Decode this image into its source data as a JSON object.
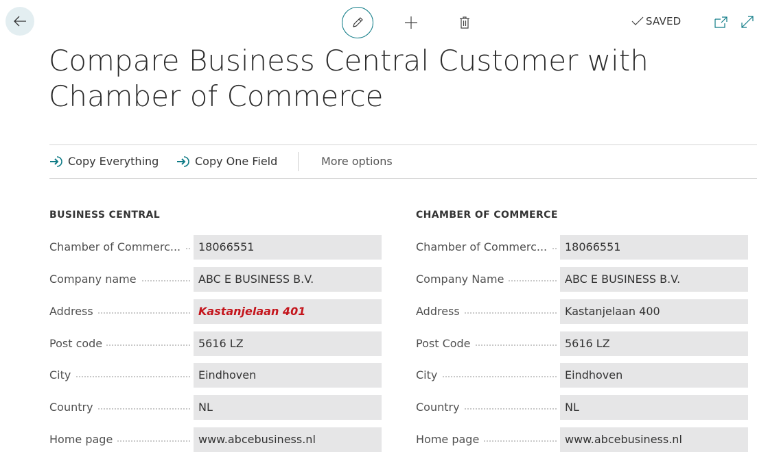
{
  "toolbar": {
    "back_icon": "arrow-left-icon",
    "edit_icon": "pencil-icon",
    "add_icon": "plus-icon",
    "delete_icon": "trash-icon",
    "status_text": "SAVED",
    "status_icon": "checkmark-icon",
    "open_new_icon": "open-in-new-window-icon",
    "expand_icon": "expand-icon",
    "accent_color": "#0f7b86"
  },
  "page": {
    "title": "Compare Business Central Customer with Chamber of Commerce"
  },
  "actions": {
    "copy_everything": "Copy Everything",
    "copy_one_field": "Copy One Field",
    "more_options": "More options",
    "action_icon": "arrow-into-icon"
  },
  "business_central": {
    "caption": "BUSINESS CENTRAL",
    "fields": [
      {
        "label": "Chamber of Commerc...",
        "value": "18066551"
      },
      {
        "label": "Company name",
        "value": "ABC E BUSINESS B.V."
      },
      {
        "label": "Address",
        "value": "Kastanjelaan 401",
        "differs": true
      },
      {
        "label": "Post code",
        "value": "5616 LZ"
      },
      {
        "label": "City",
        "value": "Eindhoven"
      },
      {
        "label": "Country",
        "value": "NL"
      },
      {
        "label": "Home page",
        "value": "www.abcebusiness.nl"
      }
    ]
  },
  "chamber_of_commerce": {
    "caption": "CHAMBER OF COMMERCE",
    "fields": [
      {
        "label": "Chamber of Commerc...",
        "value": "18066551"
      },
      {
        "label": "Company Name",
        "value": "ABC E BUSINESS B.V."
      },
      {
        "label": "Address",
        "value": "Kastanjelaan 400"
      },
      {
        "label": "Post Code",
        "value": "5616 LZ"
      },
      {
        "label": "City",
        "value": "Eindhoven"
      },
      {
        "label": "Country",
        "value": "NL"
      },
      {
        "label": "Home page",
        "value": "www.abcebusiness.nl"
      }
    ]
  },
  "colors": {
    "difference_text": "#c4151c",
    "field_background": "#e6e6e7"
  }
}
